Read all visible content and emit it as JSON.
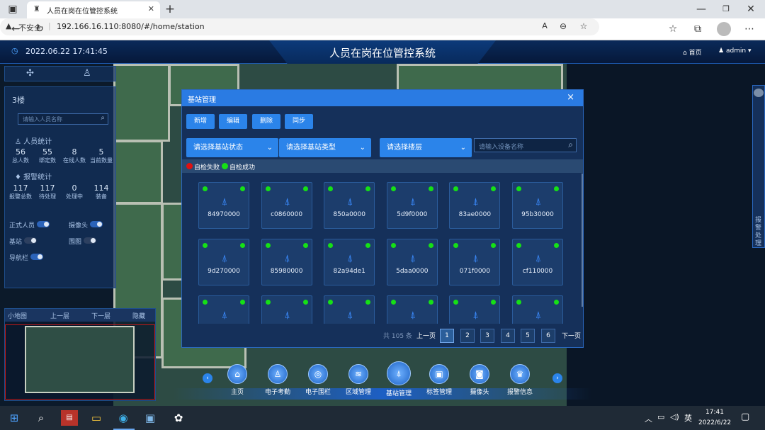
{
  "browser": {
    "tab_title": "人员在岗在位管控系统",
    "insecure_label": "不安全",
    "url": "192.166.16.110:8080/#/home/station"
  },
  "header": {
    "datetime": "2022.06.22 17:41:45",
    "title": "人员在岗在位管控系统",
    "home_label": "首页",
    "user_label": "admin"
  },
  "left_panel": {
    "floor": "3楼",
    "search_placeholder": "请输入人员名称",
    "person_stats_title": "人员统计",
    "person_stats": [
      {
        "value": "56",
        "label": "总人数"
      },
      {
        "value": "55",
        "label": "绑定数"
      },
      {
        "value": "8",
        "label": "在线人数"
      },
      {
        "value": "5",
        "label": "当前数量"
      }
    ],
    "alarm_stats_title": "报警统计",
    "alarm_stats": [
      {
        "value": "117",
        "label": "报警总数"
      },
      {
        "value": "117",
        "label": "待处理"
      },
      {
        "value": "0",
        "label": "处理中"
      },
      {
        "value": "114",
        "label": "装备"
      }
    ],
    "toggles": [
      {
        "label": "正式人员"
      },
      {
        "label": "摄像头"
      },
      {
        "label": "基站"
      },
      {
        "label": "围图"
      },
      {
        "label": "导航栏"
      }
    ]
  },
  "minimap": {
    "labels": [
      "小地图",
      "上一层",
      "下一层",
      "隐藏"
    ]
  },
  "right_tab": {
    "label": "报警处理"
  },
  "modal": {
    "title": "基站管理",
    "close": "×",
    "buttons": [
      "新增",
      "编辑",
      "删除",
      "同步"
    ],
    "filters": [
      "请选择基站状态",
      "请选择基站类型",
      "请选择楼层"
    ],
    "search_placeholder": "请输入设备名称",
    "legend": [
      {
        "label": "自检失败",
        "color": "#e01010"
      },
      {
        "label": "自检成功",
        "color": "#16e016"
      }
    ],
    "stations": [
      "84970000",
      "c0860000",
      "850a0000",
      "5d9f0000",
      "83ae0000",
      "95b30000",
      "9d270000",
      "85980000",
      "82a94de1",
      "5daa0000",
      "071f0000",
      "cf110000",
      "",
      "",
      "",
      "",
      "",
      ""
    ],
    "pagination": {
      "total": "共 105 条",
      "prev": "上一页",
      "pages": [
        "1",
        "2",
        "3",
        "4",
        "5",
        "6"
      ],
      "active": "1",
      "next": "下一页"
    }
  },
  "bottom_nav": [
    {
      "label": "主页",
      "icon": "home-icon"
    },
    {
      "label": "电子考勤",
      "icon": "attendance-icon"
    },
    {
      "label": "电子围栏",
      "icon": "fence-icon"
    },
    {
      "label": "区域管理",
      "icon": "layers-icon"
    },
    {
      "label": "基站管理",
      "icon": "antenna-icon"
    },
    {
      "label": "标签管理",
      "icon": "tag-icon"
    },
    {
      "label": "摄像头",
      "icon": "camera-icon"
    },
    {
      "label": "报警信息",
      "icon": "alarm-icon"
    }
  ],
  "taskbar": {
    "ime": "英",
    "time": "17:41",
    "date": "2022/6/22"
  }
}
